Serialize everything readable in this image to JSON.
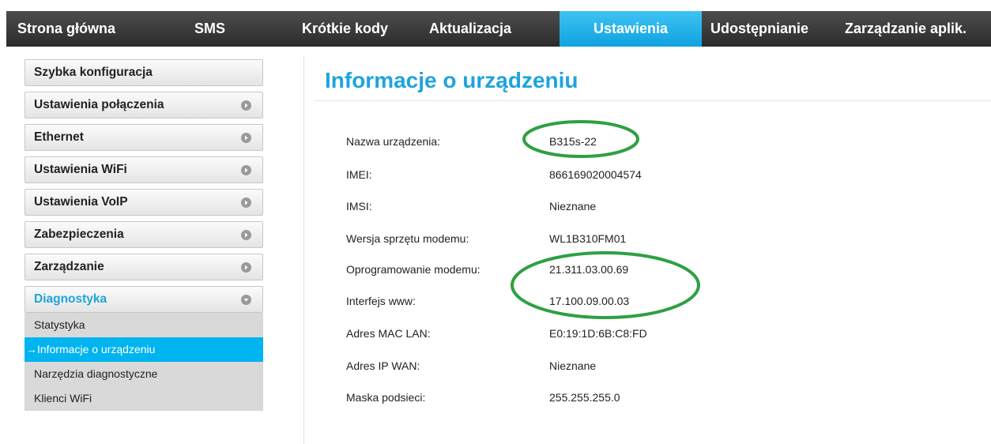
{
  "nav": {
    "items": [
      {
        "label": "Strona główna"
      },
      {
        "label": "SMS"
      },
      {
        "label": "Krótkie kody"
      },
      {
        "label": "Aktualizacja"
      },
      {
        "label": "Ustawienia"
      },
      {
        "label": "Udostępnianie"
      },
      {
        "label": "Zarządzanie aplik."
      }
    ],
    "active_index": 4
  },
  "sidebar": {
    "items": [
      {
        "label": "Szybka konfiguracja"
      },
      {
        "label": "Ustawienia połączenia"
      },
      {
        "label": "Ethernet"
      },
      {
        "label": "Ustawienia WiFi"
      },
      {
        "label": "Ustawienia VoIP"
      },
      {
        "label": "Zabezpieczenia"
      },
      {
        "label": "Zarządzanie"
      },
      {
        "label": "Diagnostyka"
      }
    ],
    "submenu": [
      {
        "label": "Statystyka"
      },
      {
        "label": "→Informacje o urządzeniu"
      },
      {
        "label": "Narzędzia diagnostyczne"
      },
      {
        "label": "Klienci WiFi"
      }
    ]
  },
  "main": {
    "title": "Informacje o urządzeniu",
    "rows": [
      {
        "label": "Nazwa urządzenia:",
        "value": "B315s-22"
      },
      {
        "label": "IMEI:",
        "value": "866169020004574"
      },
      {
        "label": "IMSI:",
        "value": "Nieznane"
      },
      {
        "label": "Wersja sprzętu modemu:",
        "value": "WL1B310FM01"
      },
      {
        "label": "Oprogramowanie modemu:",
        "value": "21.311.03.00.69"
      },
      {
        "label": "Interfejs www:",
        "value": "17.100.09.00.03"
      },
      {
        "label": "Adres MAC LAN:",
        "value": "E0:19:1D:6B:C8:FD"
      },
      {
        "label": "Adres IP WAN:",
        "value": "Nieznane"
      },
      {
        "label": "Maska podsieci:",
        "value": "255.255.255.0"
      }
    ]
  },
  "colors": {
    "accent": "#1ea4dc",
    "nav_active": "#0ea2e0",
    "annotation": "#2ea043"
  }
}
